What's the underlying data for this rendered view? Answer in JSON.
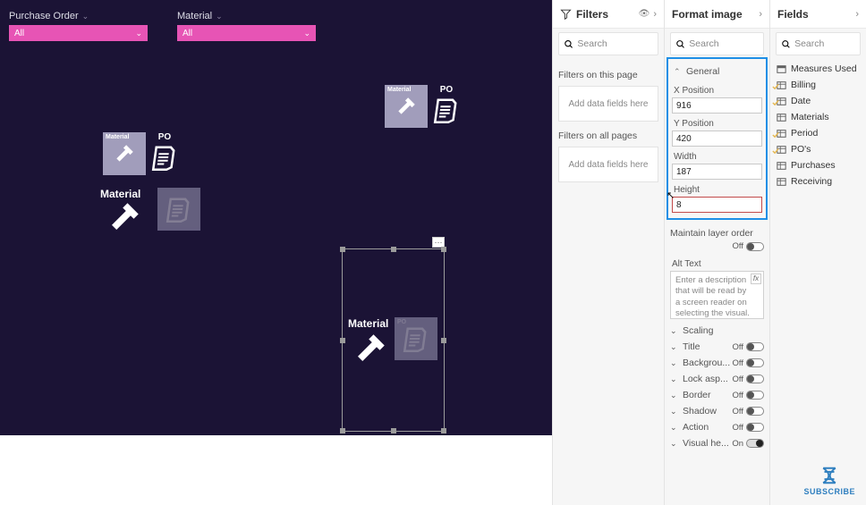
{
  "canvas": {
    "slicer_po_label": "Purchase Order",
    "slicer_po_value": "All",
    "slicer_mat_label": "Material",
    "slicer_mat_value": "All",
    "cap_material": "Material",
    "po_label": "PO"
  },
  "filters": {
    "title": "Filters",
    "search_placeholder": "Search",
    "section_page": "Filters on this page",
    "section_all": "Filters on all pages",
    "drop_hint": "Add data fields here"
  },
  "format": {
    "title": "Format image",
    "search_placeholder": "Search",
    "general": {
      "label": "General",
      "x_label": "X Position",
      "x_value": "916",
      "y_label": "Y Position",
      "y_value": "420",
      "w_label": "Width",
      "w_value": "187",
      "h_label": "Height",
      "h_value": "8"
    },
    "maintain_label": "Maintain layer order",
    "maintain_state": "Off",
    "alt_label": "Alt Text",
    "alt_placeholder": "Enter a description that will be read by a screen reader on selecting the visual.",
    "sections": [
      {
        "label": "Scaling",
        "toggle": null
      },
      {
        "label": "Title",
        "toggle": "Off"
      },
      {
        "label": "Backgrou...",
        "toggle": "Off"
      },
      {
        "label": "Lock asp...",
        "toggle": "Off"
      },
      {
        "label": "Border",
        "toggle": "Off"
      },
      {
        "label": "Shadow",
        "toggle": "Off"
      },
      {
        "label": "Action",
        "toggle": "Off"
      },
      {
        "label": "Visual he...",
        "toggle": "On"
      }
    ]
  },
  "fields": {
    "title": "Fields",
    "search_placeholder": "Search",
    "items": [
      {
        "label": "Measures Used",
        "icon": "measure",
        "checked": false
      },
      {
        "label": "Billing",
        "icon": "table",
        "checked": true
      },
      {
        "label": "Date",
        "icon": "table",
        "checked": true
      },
      {
        "label": "Materials",
        "icon": "table",
        "checked": false
      },
      {
        "label": "Period",
        "icon": "table",
        "checked": true
      },
      {
        "label": "PO's",
        "icon": "table",
        "checked": true
      },
      {
        "label": "Purchases",
        "icon": "table",
        "checked": false
      },
      {
        "label": "Receiving",
        "icon": "table",
        "checked": false
      }
    ]
  },
  "subscribe_label": "SUBSCRIBE"
}
